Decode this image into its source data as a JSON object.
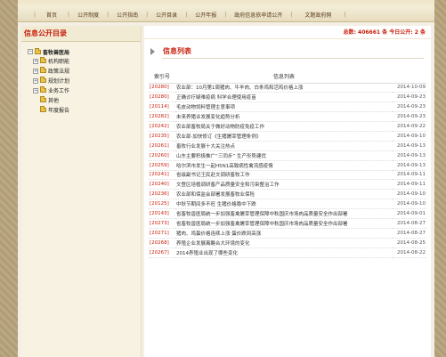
{
  "nav": {
    "items": [
      "首页",
      "公开制度",
      "公开指南",
      "公开目录",
      "公开年报",
      "政府信息依申请公开",
      "文题政府网"
    ]
  },
  "left": {
    "title": "信息公开目录",
    "root": "畜牧兽医局",
    "items": [
      "机构职能",
      "政策法规",
      "规划计划",
      "业务工作",
      "其他",
      "年度报告"
    ]
  },
  "stats": {
    "text": "总数: 406661 条  今日公开: 2 条"
  },
  "list": {
    "title": "信息列表",
    "col_index": "索引号",
    "col_name": "信息列表",
    "rows": [
      {
        "idx": "[20280]",
        "name": "农业部：10月第1周猪肉、牛羊肉、白条鸡和活鸡价格上涨",
        "date": "2014-10-09"
      },
      {
        "idx": "[20280]",
        "name": "正确诊疗疑难疫病  科学合理使用疫苗",
        "date": "2014-09-23"
      },
      {
        "idx": "[20114]",
        "name": "毛皮动物饲料管理主意事项",
        "date": "2014-09-23"
      },
      {
        "idx": "[20282]",
        "name": "未来养猪业发展变化趋势分析",
        "date": "2014-09-23"
      },
      {
        "idx": "[20242]",
        "name": "农业部畜牧局关于做好动物防疫免疫工作",
        "date": "2014-09-22"
      },
      {
        "idx": "[20235]",
        "name": "农业部·加快修订《生猪屠宰管理条例》",
        "date": "2014-09-10"
      },
      {
        "idx": "[20261]",
        "name": "畜牧行业发展十大关注热点",
        "date": "2014-09-13"
      },
      {
        "idx": "[20260]",
        "name": "山东主要积极推广“三同步”  生产形势建优",
        "date": "2014-09-13"
      },
      {
        "idx": "[20259]",
        "name": "哈尔滨市发生一起H5N1高致病性禽流感疫情",
        "date": "2014-09-13"
      },
      {
        "idx": "[20241]",
        "name": "省级副书记王民赴文调研畜牧工作",
        "date": "2014-09-11"
      },
      {
        "idx": "[20240]",
        "name": "文登区培植调研畜产品质量安全和污染整治工作",
        "date": "2014-09-11"
      },
      {
        "idx": "[20236]",
        "name": "农业部和保监会部署发展畜牧业保险",
        "date": "2014-09-10"
      },
      {
        "idx": "[20125]",
        "name": "中秋节期间多不旺  生猪价格稳中下跌",
        "date": "2014-09-10"
      },
      {
        "idx": "[20143]",
        "name": "省畜牧兽医局统一步加强畜禽屠宰管理保障中秋国庆市场肉品质量安全作出部署",
        "date": "2014-09-01"
      },
      {
        "idx": "[20273]",
        "name": "省畜牧兽医局统一步加强畜禽屠宰管理保障中秋国庆市场肉品质量安全作出部署",
        "date": "2014-08-27"
      },
      {
        "idx": "[20271]",
        "name": "猪肉、鸡蛋价格连续上涨  蛋价跌到高涨",
        "date": "2014-08-27"
      },
      {
        "idx": "[20268]",
        "name": "养殖企业发展离酪合大环境的变化",
        "date": "2014-08-25"
      },
      {
        "idx": "[20267]",
        "name": "2014养殖业出现了哪些变化",
        "date": "2014-08-22"
      }
    ]
  },
  "colors": {
    "accent_red": "#c81e0a",
    "background_pattern": "#b8a57e"
  }
}
